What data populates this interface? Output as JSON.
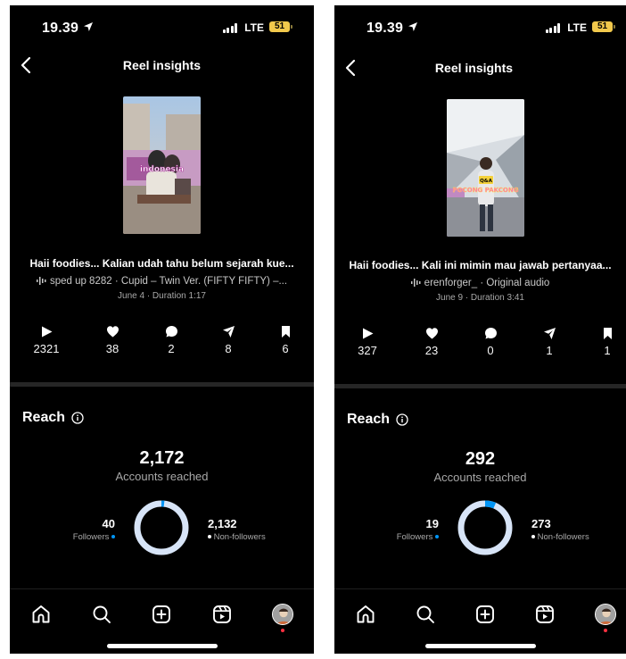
{
  "colors": {
    "accent": "#0095f6",
    "ring": "#d7e4f7",
    "divider": "#262626",
    "muted": "#a8a8a8",
    "battery": "#f2c94c"
  },
  "screens": [
    {
      "status": {
        "time": "19.39",
        "network": "LTE",
        "battery": "51",
        "location_icon": "location-arrow-icon"
      },
      "header": {
        "title": "Reel insights",
        "back_icon": "chevron-left-icon"
      },
      "reel": {
        "caption": "Haii foodies... Kalian udah tahu belum sejarah kue...",
        "audio": "sped up 8282 · Cupid – Twin Ver. (FIFTY FIFTY) –...",
        "meta": "June 4 · Duration 1:17",
        "thumbnail_text": "indonesia"
      },
      "stats": [
        {
          "icon": "play-icon",
          "value": "2321"
        },
        {
          "icon": "heart-icon",
          "value": "38"
        },
        {
          "icon": "comment-icon",
          "value": "2"
        },
        {
          "icon": "share-icon",
          "value": "8"
        },
        {
          "icon": "bookmark-icon",
          "value": "6"
        }
      ],
      "reach": {
        "title": "Reach",
        "accounts_reached": "2,172",
        "accounts_label": "Accounts reached",
        "followers": "40",
        "followers_label": "Followers",
        "non_followers": "2,132",
        "non_followers_label": "Non-followers",
        "followers_fraction": 0.018
      }
    },
    {
      "status": {
        "time": "19.39",
        "network": "LTE",
        "battery": "51",
        "location_icon": "location-arrow-icon"
      },
      "header": {
        "title": "Reel insights",
        "back_icon": "chevron-left-icon"
      },
      "reel": {
        "caption": "Haii foodies... Kali ini mimin mau jawab pertanyaa...",
        "audio": "erenforger_ · Original audio",
        "meta": "June 9 · Duration 3:41",
        "thumbnail_text": "POCONG PAKCONG",
        "thumbnail_badge": "Q&A"
      },
      "stats": [
        {
          "icon": "play-icon",
          "value": "327"
        },
        {
          "icon": "heart-icon",
          "value": "23"
        },
        {
          "icon": "comment-icon",
          "value": "0"
        },
        {
          "icon": "share-icon",
          "value": "1"
        },
        {
          "icon": "bookmark-icon",
          "value": "1"
        }
      ],
      "reach": {
        "title": "Reach",
        "accounts_reached": "292",
        "accounts_label": "Accounts reached",
        "followers": "19",
        "followers_label": "Followers",
        "non_followers": "273",
        "non_followers_label": "Non-followers",
        "followers_fraction": 0.065
      }
    }
  ],
  "tabbar": [
    {
      "icon": "home-icon"
    },
    {
      "icon": "search-icon"
    },
    {
      "icon": "create-plus-icon"
    },
    {
      "icon": "reels-icon"
    },
    {
      "icon": "profile-avatar-icon"
    }
  ]
}
